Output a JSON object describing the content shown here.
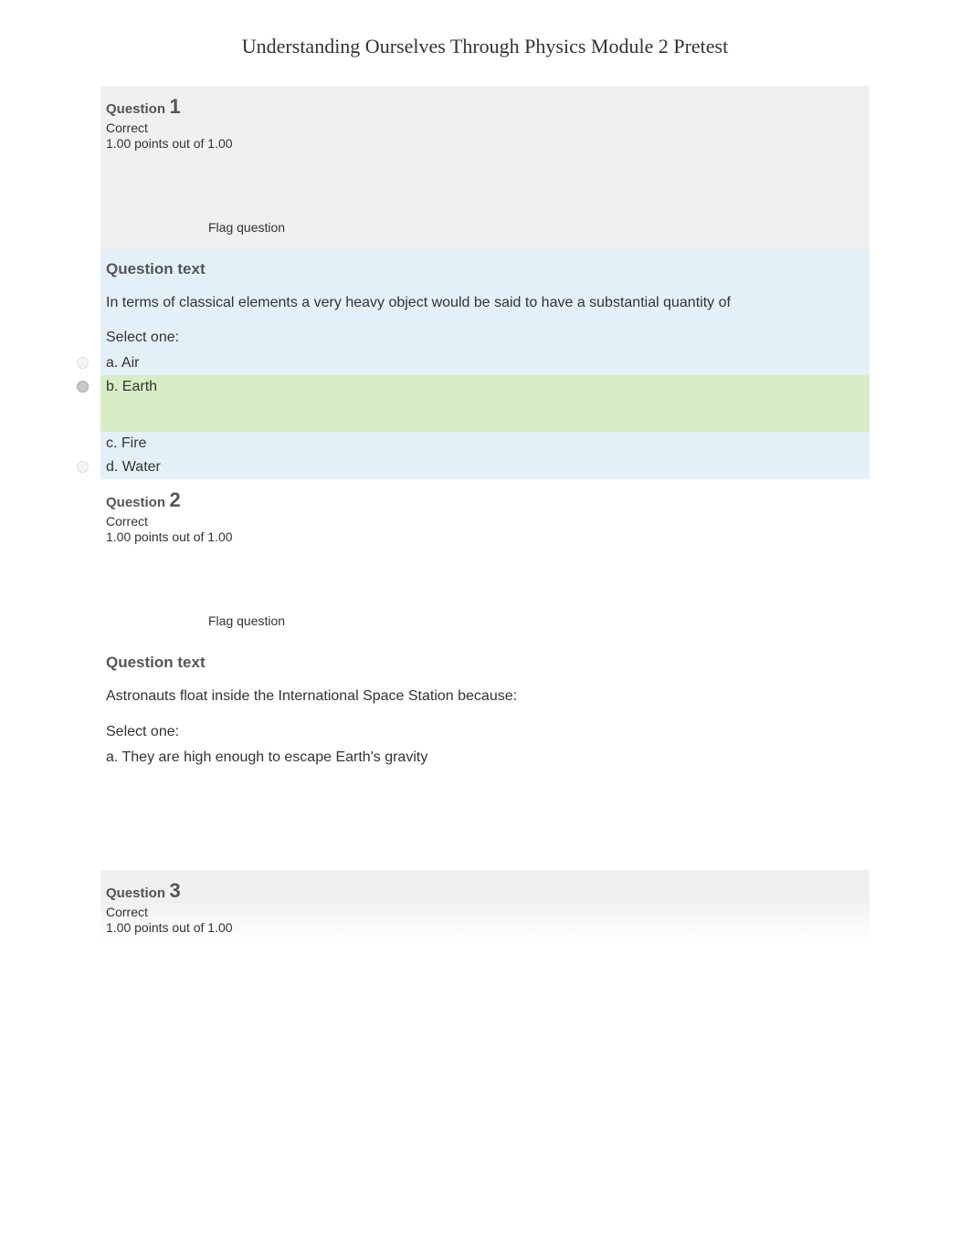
{
  "page_title": "Understanding Ourselves Through Physics Module 2 Pretest",
  "question_label": "Question",
  "question_text_heading": "Question text",
  "select_one": "Select one:",
  "flag_label": "Flag question",
  "q1": {
    "number": "1",
    "status": "Correct",
    "points": "1.00 points out of 1.00",
    "prompt": "In terms of classical elements a very heavy object would be said to have a substantial quantity of",
    "options": {
      "a": "a. Air",
      "b": "b. Earth",
      "c": "c. Fire",
      "d": "d. Water"
    }
  },
  "q2": {
    "number": "2",
    "status": "Correct",
    "points": "1.00 points out of 1.00",
    "prompt": "Astronauts float inside the International Space Station because:",
    "options": {
      "a": "a. They are high enough to escape Earth's gravity"
    }
  },
  "q3": {
    "number": "3",
    "status": "Correct",
    "points": "1.00 points out of 1.00"
  }
}
